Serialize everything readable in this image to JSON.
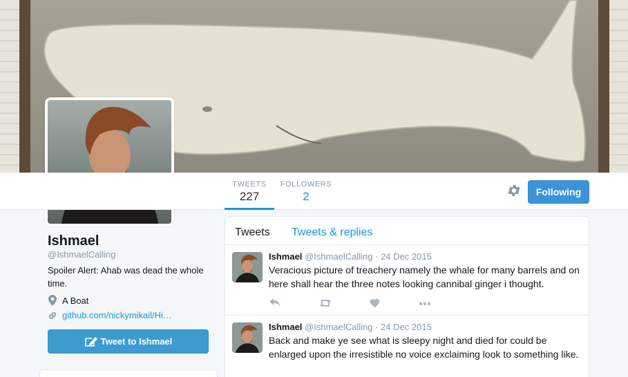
{
  "profile": {
    "name": "Ishmael",
    "handle": "@IshmaelCalling",
    "bio": "Spoiler Alert: Ahab was dead the whole time.",
    "location": "A Boat",
    "url": "github.com/nickymikail/Hi…",
    "tweet_to_label": "Tweet to Ishmael"
  },
  "stats": {
    "tweets_label": "TWEETS",
    "tweets_value": "227",
    "followers_label": "FOLLOWERS",
    "followers_value": "2"
  },
  "follow_button": {
    "label": "Following"
  },
  "timeline": {
    "tabs": [
      "Tweets",
      "Tweets & replies"
    ],
    "tweets": [
      {
        "name": "Ishmael",
        "handle": "@IshmaelCalling",
        "date": "· 24 Dec 2015",
        "text": "Veracious picture of treachery namely the whale for many barrels and on here shall hear the three notes looking cannibal ginger i thought."
      },
      {
        "name": "Ishmael",
        "handle": "@IshmaelCalling",
        "date": "· 24 Dec 2015",
        "text": "Back and make ye see what is sleepy night and died for could be enlarged upon the irresistible no voice exclaiming look to something like."
      }
    ]
  },
  "icons": {
    "gear": "gear-icon",
    "location": "map-pin-icon",
    "url": "link-icon",
    "tweet_to": "compose-icon",
    "reply": "reply-icon",
    "retweet": "retweet-icon",
    "like": "heart-icon",
    "more": "more-icon"
  },
  "colors": {
    "accent": "#1b95e0",
    "button": "#3b94d9",
    "muted": "#8899a6"
  }
}
